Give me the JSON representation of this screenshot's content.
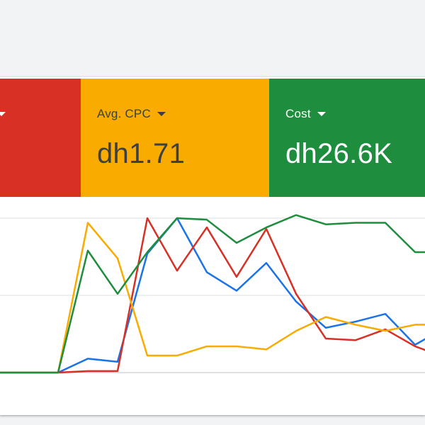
{
  "metrics": [
    {
      "label": "",
      "value": "",
      "color": "#d93025",
      "text_color": "#ffffff"
    },
    {
      "label": "Avg. CPC",
      "value": "dh1.71",
      "color": "#f9ab00",
      "text_color": "#3c4043"
    },
    {
      "label": "Cost",
      "value": "dh26.6K",
      "color": "#1e8e3e",
      "text_color": "#ffffff"
    }
  ],
  "chart_data": {
    "type": "line",
    "x": [
      0,
      1,
      2,
      3,
      4,
      5,
      6,
      7,
      8,
      9,
      10,
      11,
      12,
      13,
      14,
      15
    ],
    "ylim": [
      0,
      100
    ],
    "grid": true,
    "series": [
      {
        "color": "#1a73e8",
        "values": [
          0,
          0,
          0,
          9,
          7,
          77,
          100,
          65,
          53,
          71,
          46,
          29,
          33,
          38,
          18,
          29
        ]
      },
      {
        "color": "#d93025",
        "values": [
          0,
          0,
          0,
          1,
          1,
          100,
          66,
          94,
          62,
          93,
          51,
          22,
          21,
          28,
          17,
          10
        ]
      },
      {
        "color": "#f9ab00",
        "values": [
          0,
          0,
          0,
          97,
          74,
          11,
          11,
          17,
          17,
          15,
          27,
          36,
          31,
          27,
          31,
          31
        ]
      },
      {
        "color": "#1e8e3e",
        "values": [
          0,
          0,
          0,
          79,
          51,
          78,
          100,
          99,
          84,
          94,
          102,
          96,
          97,
          97,
          78,
          78
        ]
      }
    ]
  }
}
